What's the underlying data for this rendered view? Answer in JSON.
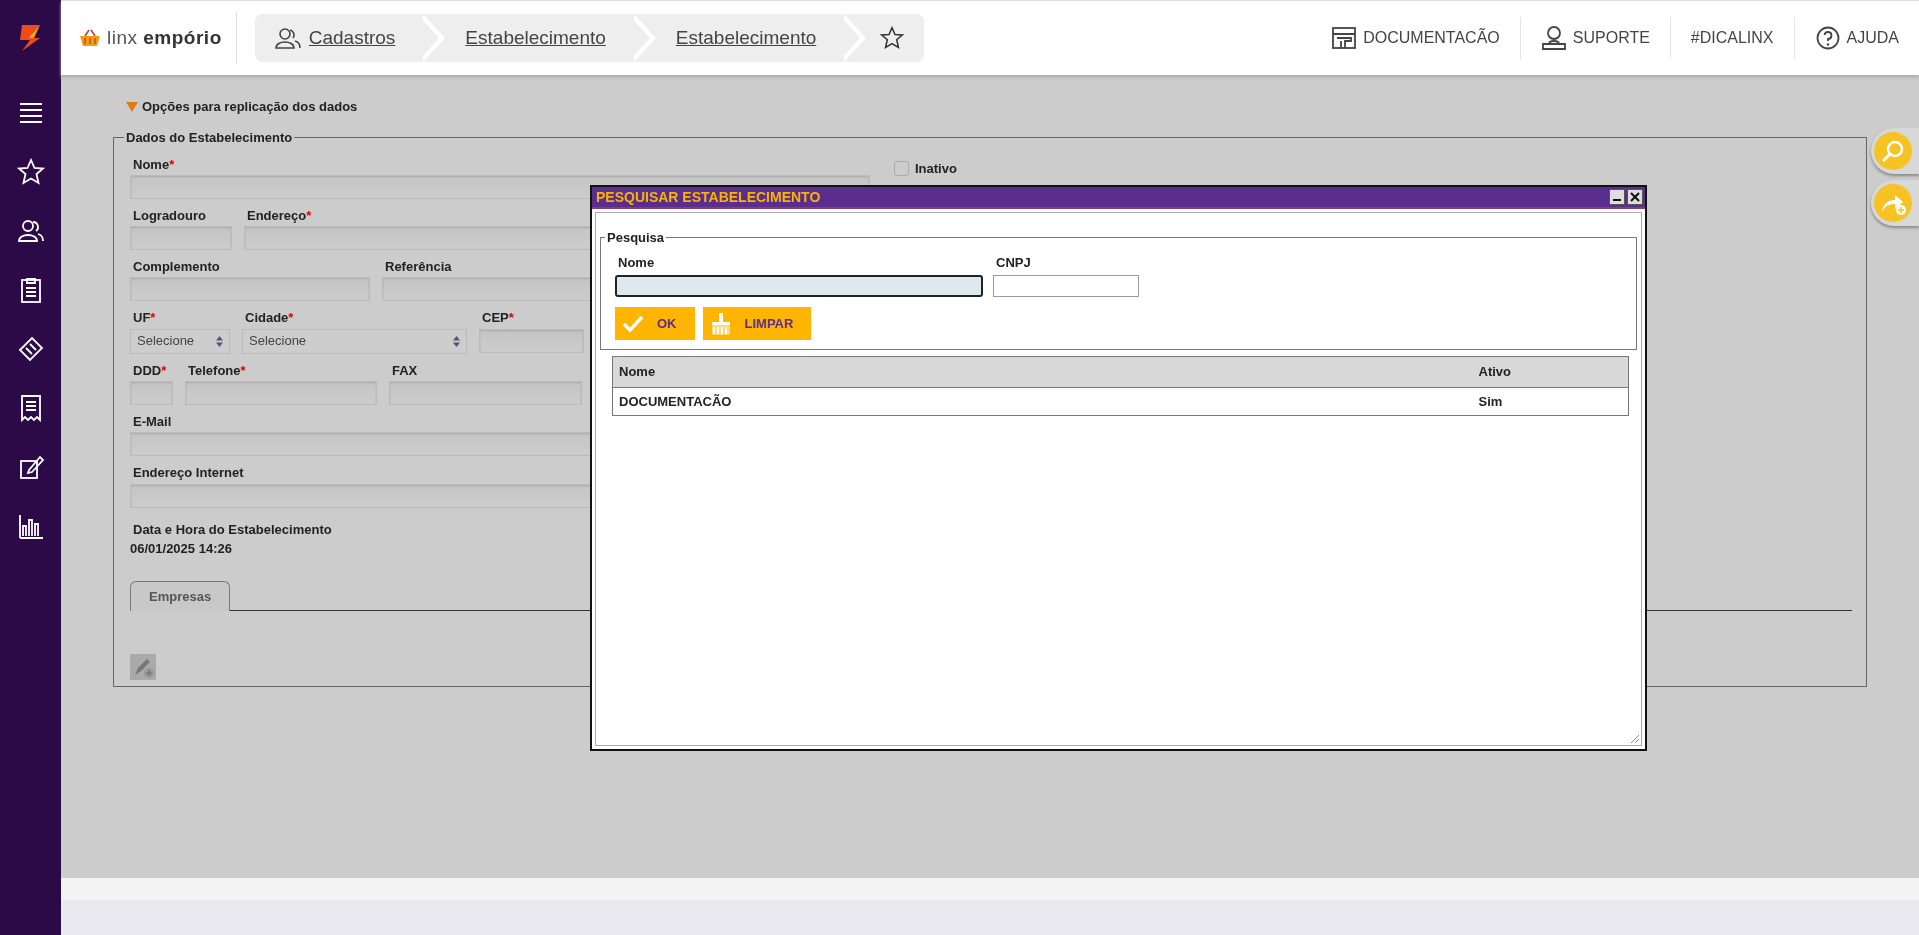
{
  "header": {
    "brand": "linx",
    "brand_bold": "empório",
    "breadcrumbs": [
      {
        "kind": "section",
        "label": "Cadastros"
      },
      {
        "kind": "page",
        "label": "Estabelecimento"
      },
      {
        "kind": "page",
        "label": "Estabelecimento"
      },
      {
        "kind": "favorite"
      }
    ],
    "links": [
      {
        "kind": "store",
        "label": "DOCUMENTACÃO"
      },
      {
        "kind": "person",
        "label": "SUPORTE"
      },
      {
        "kind": "text",
        "label": "#DICALINX"
      },
      {
        "kind": "help",
        "label": "AJUDA"
      }
    ]
  },
  "replication_toggle": {
    "label": "Opções para replicação dos dados",
    "expanded": true
  },
  "form": {
    "legend": "Dados do Estabelecimento",
    "rows": [
      [
        {
          "kind": "text",
          "label": "Nome",
          "required_mark": "*"
        },
        {
          "kind": "checkbox",
          "label": "Inativo",
          "checked": false
        }
      ],
      [
        {
          "kind": "text",
          "label": "Logradouro"
        },
        {
          "kind": "text",
          "label": "Endereço",
          "required_mark": "*"
        }
      ],
      [
        {
          "kind": "text",
          "label": "Complemento"
        },
        {
          "kind": "text",
          "label": "Referência"
        }
      ],
      [
        {
          "kind": "select",
          "label": "UF",
          "required_mark": "*",
          "value": "Selecione"
        },
        {
          "kind": "select",
          "label": "Cidade",
          "required_mark": "*",
          "value": "Selecione"
        },
        {
          "kind": "text",
          "label": "CEP",
          "required_mark": "*"
        }
      ],
      [
        {
          "kind": "text",
          "label": "DDD",
          "required_mark": "*"
        },
        {
          "kind": "text",
          "label": "Telefone",
          "required_mark": "*"
        },
        {
          "kind": "text",
          "label": "FAX"
        }
      ],
      [
        {
          "kind": "text",
          "label": "E-Mail"
        }
      ],
      [
        {
          "kind": "text",
          "label": "Endereço Internet"
        }
      ]
    ],
    "datetime": {
      "label": "Data e Hora do Estabelecimento",
      "value": "06/01/2025 14:26"
    },
    "tabs": [
      {
        "label": "Empresas",
        "selected": true
      }
    ]
  },
  "dialog": {
    "title": "PESQUISAR ESTABELECIMENTO",
    "legend": "Pesquisa",
    "fields": [
      {
        "label": "Nome",
        "focused": true
      },
      {
        "label": "CNPJ",
        "focused": false
      }
    ],
    "buttons": [
      {
        "kind": "confirm",
        "label": "OK"
      },
      {
        "kind": "clear",
        "label": "LIMPAR"
      }
    ],
    "table": {
      "columns": [
        "Nome",
        "Ativo"
      ],
      "rows": [
        [
          "DOCUMENTACÃO",
          "Sim"
        ]
      ]
    }
  }
}
